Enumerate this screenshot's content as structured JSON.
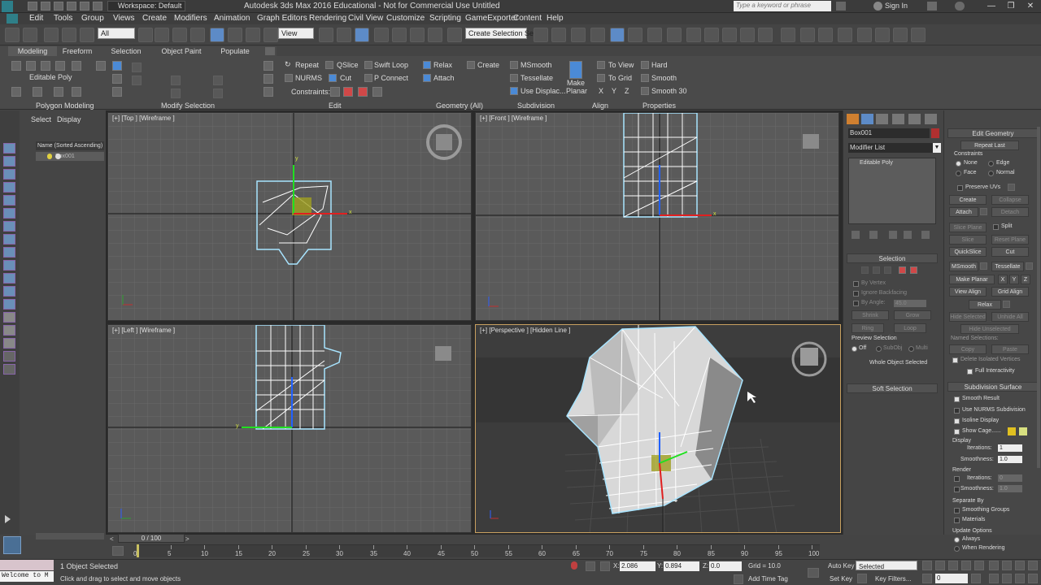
{
  "titlebar": {
    "title": "Autodesk 3ds Max 2016 Educational - Not for Commercial Use   Untitled",
    "workspace": "Workspace: Default",
    "search_placeholder": "Type a keyword or phrase",
    "signin": "Sign In",
    "minimize": "—",
    "restore": "❐",
    "close": "✕"
  },
  "menubar": [
    "Edit",
    "Tools",
    "Group",
    "Views",
    "Create",
    "Modifiers",
    "Animation",
    "Graph Editors",
    "Rendering",
    "Civil View",
    "Customize",
    "Scripting",
    "GameExporter",
    "Content",
    "Help"
  ],
  "toolbar": {
    "selection_filter": "All",
    "reference_coord": "View",
    "named_selection": "Create Selection Set"
  },
  "ribbon": {
    "tabs": [
      "Modeling",
      "Freeform",
      "Selection",
      "Object Paint",
      "Populate"
    ],
    "active_tab": "Modeling",
    "panel_label": "Editable Poly",
    "edit": {
      "repeat": "Repeat",
      "qslice": "QSlice",
      "swift_loop": "Swift Loop",
      "nurms": "NURMS",
      "cut": "Cut",
      "p_connect": "P Connect",
      "constraints": "Constraints:"
    },
    "geometry": {
      "relax": "Relax",
      "create": "Create",
      "attach": "Attach"
    },
    "subdivision": {
      "msmooth": "MSmooth",
      "tessellate": "Tessellate",
      "use_displac": "Use Displac..."
    },
    "make_planar": "Make Planar",
    "align": {
      "to_view": "To View",
      "to_grid": "To Grid",
      "x": "X",
      "y": "Y",
      "z": "Z"
    },
    "properties": {
      "hard": "Hard",
      "smooth": "Smooth",
      "smooth30": "Smooth 30"
    },
    "groups": [
      "Polygon Modeling",
      "Modify Selection",
      "Edit",
      "Geometry (All)",
      "Subdivision",
      "Align",
      "Properties"
    ]
  },
  "scene_explorer": {
    "tabs": [
      "Select",
      "Display"
    ],
    "header": "Name (Sorted Ascending)",
    "object": "Box001"
  },
  "viewports": [
    {
      "label": "[+] [Top ] [Wireframe ]"
    },
    {
      "label": "[+] [Front ] [Wireframe ]"
    },
    {
      "label": "[+] [Left ] [Wireframe ]"
    },
    {
      "label": "[+] [Perspective ] [Hidden Line ]"
    }
  ],
  "axes": {
    "x": "x",
    "y": "y",
    "z": "z"
  },
  "command_panel": {
    "object_name": "Box001",
    "modifier_list": "Modifier List",
    "stack_item": "Editable Poly",
    "selection": {
      "header": "Selection",
      "by_vertex": "By Vertex",
      "ignore_backfacing": "Ignore Backfacing",
      "by_angle": "By Angle:",
      "angle_value": "45.0",
      "shrink": "Shrink",
      "grow": "Grow",
      "ring": "Ring",
      "loop": "Loop",
      "preview": "Preview Selection",
      "off": "Off",
      "subobj": "SubObj",
      "multi": "Multi",
      "whole_object": "Whole Object Selected"
    },
    "soft_selection": "Soft Selection"
  },
  "edit_geometry": {
    "header": "Edit Geometry",
    "repeat_last": "Repeat Last",
    "constraints": "Constraints",
    "none": "None",
    "edge": "Edge",
    "face": "Face",
    "normal": "Normal",
    "preserve_uvs": "Preserve UVs",
    "create": "Create",
    "collapse": "Collapse",
    "attach": "Attach",
    "detach": "Detach",
    "slice_plane": "Slice Plane",
    "split": "Split",
    "slice": "Slice",
    "reset_plane": "Reset Plane",
    "quickslice": "QuickSlice",
    "cut": "Cut",
    "msmooth": "MSmooth",
    "tessellate": "Tessellate",
    "make_planar": "Make Planar",
    "x": "X",
    "y": "Y",
    "z": "Z",
    "view_align": "View Align",
    "grid_align": "Grid Align",
    "relax": "Relax",
    "hide_selected": "Hide Selected",
    "unhide_all": "Unhide All",
    "hide_unselected": "Hide Unselected",
    "named_selections": "Named Selections:",
    "copy": "Copy",
    "paste": "Paste",
    "delete_isolated": "Delete Isolated Vertices",
    "full_interactivity": "Full Interactivity"
  },
  "subdivision_surface": {
    "header": "Subdivision Surface",
    "smooth_result": "Smooth Result",
    "use_nurms": "Use NURMS Subdivision",
    "isoline": "Isoline Display",
    "show_cage": "Show Cage......",
    "display": "Display",
    "iterations": "Iterations:",
    "iter_value": "1",
    "smoothness": "Smoothness:",
    "smooth_value": "1.0",
    "render": "Render",
    "r_iterations": "Iterations:",
    "r_iter_value": "0",
    "r_smoothness": "Smoothness:",
    "r_smooth_value": "1.0",
    "separate_by": "Separate By",
    "smoothing_groups": "Smoothing Groups",
    "materials": "Materials",
    "update_options": "Update Options",
    "always": "Always",
    "when_rendering": "When Rendering"
  },
  "timeline": {
    "frame": "0 / 100",
    "ticks": [
      "0",
      "5",
      "10",
      "15",
      "20",
      "25",
      "30",
      "35",
      "40",
      "45",
      "50",
      "55",
      "60",
      "65",
      "70",
      "75",
      "80",
      "85",
      "90",
      "95",
      "100"
    ]
  },
  "status": {
    "maxscript": "Welcome to M",
    "selected": "1 Object Selected",
    "prompt": "Click and drag to select and move objects",
    "x_label": "X:",
    "x": "2.086",
    "y_label": "Y:",
    "y": "0.894",
    "z_label": "Z:",
    "z": "0.0",
    "grid": "Grid = 10.0",
    "add_time_tag": "Add Time Tag",
    "auto_key": "Auto Key",
    "selected_dd": "Selected",
    "set_key": "Set Key",
    "key_filters": "Key Filters...",
    "frame_value": "0"
  }
}
